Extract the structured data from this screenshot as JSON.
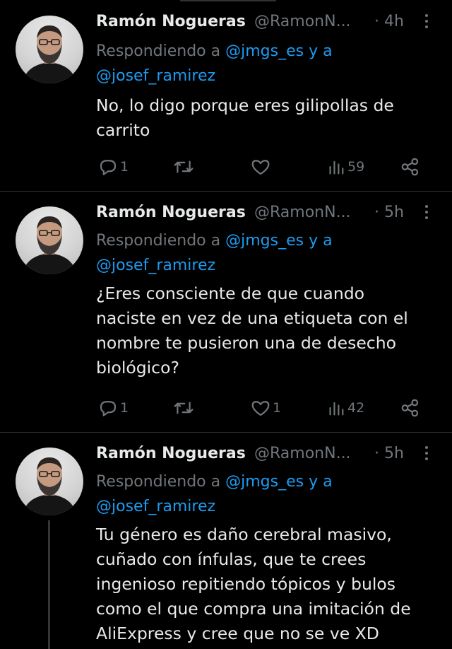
{
  "tweets": [
    {
      "name": "Ramón Nogueras",
      "handle": "@RamonN...",
      "time": "· 4h",
      "replying_prefix": "Respondiendo a",
      "mention1": "@jmgs_es",
      "replying_and": "y a",
      "mention2": "@josef_ramirez",
      "lines": [
        "No, lo digo porque eres gilipollas de",
        "carrito"
      ],
      "replies": "1",
      "retweets": "",
      "likes": "",
      "views": "59"
    },
    {
      "name": "Ramón Nogueras",
      "handle": "@RamonN...",
      "time": "· 5h",
      "replying_prefix": "Respondiendo a",
      "mention1": "@jmgs_es",
      "replying_and": "y a",
      "mention2": "@josef_ramirez",
      "lines": [
        "¿Eres consciente de que cuando",
        "naciste en vez de una etiqueta con el",
        "nombre te pusieron una de desecho",
        "biológico?"
      ],
      "replies": "1",
      "retweets": "",
      "likes": "1",
      "views": "42"
    },
    {
      "name": "Ramón Nogueras",
      "handle": "@RamonN...",
      "time": "· 5h",
      "replying_prefix": "Respondiendo a",
      "mention1": "@jmgs_es",
      "replying_and": "y a",
      "mention2": "@josef_ramirez",
      "lines": [
        "Tu género es daño cerebral masivo,",
        "cuñado con ínfulas, que te crees",
        "ingenioso repitiendo tópicos y bulos",
        "como el que compra una imitación de",
        "AliExpress y cree que no se ve XD"
      ]
    }
  ],
  "icons": {
    "reply": "reply-icon",
    "retweet": "retweet-icon",
    "like": "like-icon",
    "views": "views-icon",
    "share": "share-icon",
    "more": "more-icon"
  },
  "colors": {
    "background": "#000000",
    "text": "#e7e9ea",
    "muted": "#71767b",
    "accent": "#1d9bf0",
    "divider": "#2f3336"
  }
}
